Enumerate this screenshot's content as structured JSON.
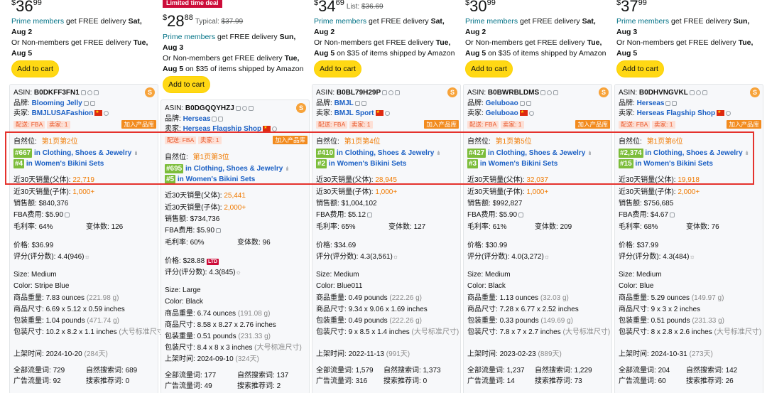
{
  "common": {
    "prime": "Prime members",
    "nonmembers": "Or Non-members get FREE delivery",
    "free_delivery": "get FREE delivery",
    "add_to_cart": "Add to cart",
    "asin_label": "ASIN:",
    "brand_label": "品牌:",
    "seller_label": "卖家:",
    "fba_tag": "配送: FBA",
    "seller_count_prefix": "卖家:",
    "add_library": "加入产品库",
    "natural_pos": "自然位:",
    "in": "in",
    "sales30_parent": "近30天销量(父体):",
    "sales30_child": "近30天销量(子体):",
    "revenue": "销售额:",
    "fba_fee": "FBA费用:",
    "margin": "毛利率:",
    "variants": "变体数:",
    "price_label": "价格:",
    "rating_label": "评分(评分数):",
    "size_label": "Size:",
    "color_label": "Color:",
    "weight_label": "商品重量:",
    "dims_label": "商品尺寸:",
    "pkg_weight_label": "包装重量:",
    "pkg_dims_label": "包装尺寸:",
    "listed_label": "上架时间:",
    "all_traffic": "全部流量词:",
    "natural_search": "自然搜索词:",
    "ad_traffic": "广告流量词:",
    "search_rec": "搜索推荐词:",
    "s_badge": "S",
    "ltd_badge": "LTD",
    "limited_deal": "Limited time deal",
    "sun_icon": "☼",
    "bars_icon": "ılı",
    "on_35": "on $35 of items shipped by Amazon",
    "large_std": "(大号标准尺寸)"
  },
  "products": [
    {
      "price_dollars": "36",
      "price_cents": "99",
      "delivery_line1": "Sat, Aug 2",
      "delivery_line2": "Tue, Aug 5",
      "asin": "B0DKFF3FN1",
      "brand": "Blooming Jelly",
      "seller": "BMJLUSAFashion",
      "seller_count": "1",
      "page_pos": "第1页第2位",
      "rank1": "#667",
      "cat1": "Clothing, Shoes & Jewelry",
      "rank2": "#4",
      "cat2": "Women's Bikini Sets",
      "sales_parent": "22,719",
      "sales_child": "1,000+",
      "revenue": "$840,376",
      "fba_fee": "$5.90",
      "margin": "64%",
      "variants": "126",
      "price": "$36.99",
      "rating": "4.4(946)",
      "size": "Medium",
      "color": "Stripe Blue",
      "weight": "7.83 ounces",
      "weight_g": "(221.98 g)",
      "dims": "6.69 x 5.12 x 0.59 inches",
      "pkg_weight": "1.04 pounds",
      "pkg_weight_g": "(471.74 g)",
      "pkg_dims": "10.2 x 8.2 x 1.1 inches",
      "listed": "2024-10-20",
      "listed_days": "(284天)",
      "all_traffic": "729",
      "natural": "689",
      "ad": "92",
      "rec": "0"
    },
    {
      "price_dollars": "28",
      "price_cents": "88",
      "typical": "Typical:",
      "list_price": "$37.99",
      "delivery_line1": "Sun, Aug 3",
      "delivery_line2": "Tue, Aug 5",
      "asin": "B0DGQQYHZJ",
      "brand": "Herseas",
      "seller": "Herseas Flagship Shop",
      "seller_count": "1",
      "page_pos": "第1页第3位",
      "rank1": "#695",
      "cat1": "Clothing, Shoes & Jewelry",
      "rank2": "#5",
      "cat2": "Women's Bikini Sets",
      "sales_parent": "25,441",
      "sales_child": "2,000+",
      "revenue": "$734,736",
      "fba_fee": "$5.90",
      "margin": "60%",
      "variants": "96",
      "price": "$28.88",
      "rating": "4.3(845)",
      "size": "Large",
      "color": "Black",
      "weight": "6.74 ounces",
      "weight_g": "(191.08 g)",
      "dims": "8.58 x 8.27 x 2.76 inches",
      "pkg_weight": "0.51 pounds",
      "pkg_weight_g": "(231.33 g)",
      "pkg_dims": "8.4 x 8 x 3 inches",
      "listed": "2024-09-10",
      "listed_days": "(324天)",
      "all_traffic": "177",
      "natural": "137",
      "ad": "49",
      "rec": "2"
    },
    {
      "price_dollars": "34",
      "price_cents": "69",
      "typical": "List:",
      "list_price": "$36.69",
      "delivery_line1": "Sat, Aug 2",
      "delivery_line2": "Tue, Aug 5",
      "asin": "B0BL79H29P",
      "brand": "BMJL",
      "seller": "BMJL Sport",
      "seller_count": "1",
      "page_pos": "第1页第4位",
      "rank1": "#410",
      "cat1": "Clothing, Shoes & Jewelry",
      "rank2": "#2",
      "cat2": "Women's Bikini Sets",
      "sales_parent": "28,945",
      "sales_child": "1,000+",
      "revenue": "$1,004,102",
      "fba_fee": "$5.12",
      "margin": "65%",
      "variants": "127",
      "price": "$34.69",
      "rating": "4.3(3,561)",
      "size": "Medium",
      "color": "Blue011",
      "weight": "0.49 pounds",
      "weight_g": "(222.26 g)",
      "dims": "9.34 x 9.06 x 1.69 inches",
      "pkg_weight": "0.49 pounds",
      "pkg_weight_g": "(222.26 g)",
      "pkg_dims": "9 x 8.5 x 1.4 inches",
      "listed": "2022-11-13",
      "listed_days": "(991天)",
      "all_traffic": "1,579",
      "natural": "1,373",
      "ad": "316",
      "rec": "0"
    },
    {
      "price_dollars": "30",
      "price_cents": "99",
      "delivery_line1": "Sat, Aug 2",
      "delivery_line2": "Tue, Aug 5",
      "asin": "B0BWRBLDMS",
      "brand": "Geluboao",
      "seller": "Geluboao",
      "seller_count": "1",
      "page_pos": "第1页第5位",
      "rank1": "#427",
      "cat1": "Clothing, Shoes & Jewelry",
      "rank2": "#3",
      "cat2": "Women's Bikini Sets",
      "sales_parent": "32,037",
      "sales_child": "1,000+",
      "revenue": "$992,827",
      "fba_fee": "$5.90",
      "margin": "61%",
      "variants": "209",
      "price": "$30.99",
      "rating": "4.0(3,272)",
      "size": "Medium",
      "color": "Black",
      "weight": "1.13 ounces",
      "weight_g": "(32.03 g)",
      "dims": "7.28 x 6.77 x 2.52 inches",
      "pkg_weight": "0.33 pounds",
      "pkg_weight_g": "(149.69 g)",
      "pkg_dims": "7.8 x 7 x 2.7 inches",
      "listed": "2023-02-23",
      "listed_days": "(889天)",
      "all_traffic": "1,237",
      "natural": "1,229",
      "ad": "14",
      "rec": "73"
    },
    {
      "price_dollars": "37",
      "price_cents": "99",
      "delivery_line1": "Sun, Aug 3",
      "delivery_line2": "Tue, Aug 5",
      "asin": "B0DHVNGVKL",
      "brand": "Herseas",
      "seller": "Herseas Flagship Shop",
      "seller_count": "1",
      "page_pos": "第1页第6位",
      "rank1": "#2,374",
      "cat1": "Clothing, Shoes & Jewelry",
      "rank2": "#15",
      "cat2": "Women's Bikini Sets",
      "sales_parent": "19,918",
      "sales_child": "2,000+",
      "revenue": "$756,685",
      "fba_fee": "$4.67",
      "margin": "68%",
      "variants": "76",
      "price": "$37.99",
      "rating": "4.3(484)",
      "size": "Medium",
      "color": "Blue",
      "weight": "5.29 ounces",
      "weight_g": "(149.97 g)",
      "dims": "9 x 3 x 2 inches",
      "pkg_weight": "0.51 pounds",
      "pkg_weight_g": "(231.33 g)",
      "pkg_dims": "8 x 2.8 x 2.6 inches",
      "listed": "2024-10-31",
      "listed_days": "(273天)",
      "all_traffic": "204",
      "natural": "142",
      "ad": "60",
      "rec": "26"
    }
  ]
}
